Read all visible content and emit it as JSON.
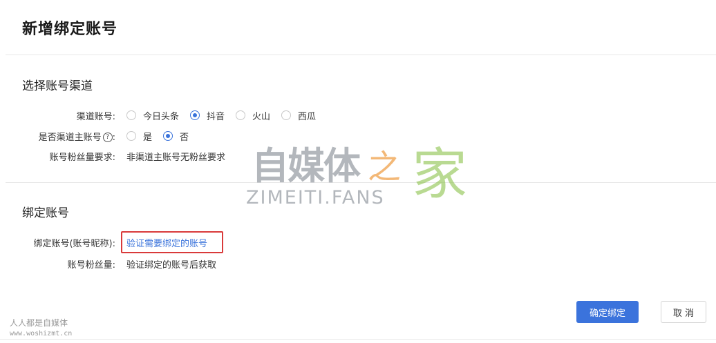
{
  "page": {
    "title": "新增绑定账号"
  },
  "channel_section": {
    "title": "选择账号渠道",
    "channel_label": "渠道账号:",
    "channels": [
      {
        "label": "今日头条",
        "checked": false
      },
      {
        "label": "抖音",
        "checked": true
      },
      {
        "label": "火山",
        "checked": false
      },
      {
        "label": "西瓜",
        "checked": false
      }
    ],
    "main_account_label": "是否渠道主账号",
    "main_account_help_icon": "?",
    "main_account_colon": ":",
    "main_account_options": [
      {
        "label": "是",
        "checked": false
      },
      {
        "label": "否",
        "checked": true
      }
    ],
    "fans_requirement_label": "账号粉丝量要求:",
    "fans_requirement_value": "非渠道主账号无粉丝要求"
  },
  "bind_section": {
    "title": "绑定账号",
    "account_label": "绑定账号(账号昵称):",
    "verify_link": "验证需要绑定的账号",
    "fans_label": "账号粉丝量:",
    "fans_value": "验证绑定的账号后获取"
  },
  "actions": {
    "confirm": "确定绑定",
    "cancel": "取 消"
  },
  "watermark": {
    "cn": "自媒体",
    "zhi": "之",
    "jia": "家",
    "en": "ZIMEITI.FANS"
  },
  "corner_watermark": {
    "cn": "人人都是自媒体",
    "url": "www.woshizmt.cn"
  },
  "colors": {
    "primary": "#3b73dc",
    "highlight_border": "#d93a3a",
    "link": "#3a73db"
  }
}
